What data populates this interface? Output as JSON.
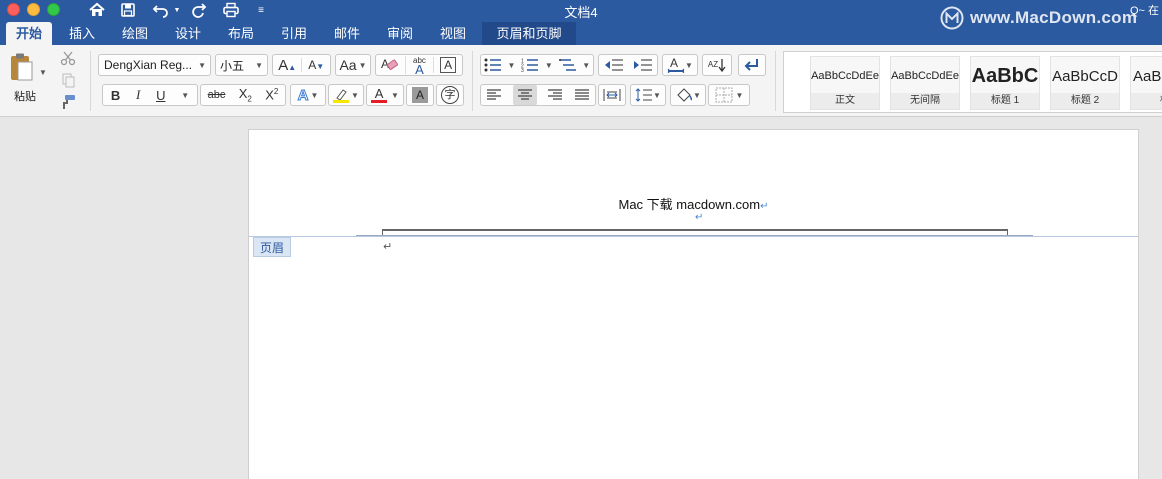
{
  "window": {
    "title": "文档4",
    "watermark": "www.MacDown.com",
    "search_hint": "Q~ 在"
  },
  "tabs": [
    {
      "label": "开始",
      "active": true
    },
    {
      "label": "插入"
    },
    {
      "label": "绘图"
    },
    {
      "label": "设计"
    },
    {
      "label": "布局"
    },
    {
      "label": "引用"
    },
    {
      "label": "邮件"
    },
    {
      "label": "审阅"
    },
    {
      "label": "视图"
    },
    {
      "label": "页眉和页脚",
      "contextual": true
    }
  ],
  "ribbon": {
    "paste_label": "粘贴",
    "font_name": "DengXian Reg...",
    "font_size": "小五",
    "grow_font": "A",
    "shrink_font": "A",
    "case": "Aa",
    "phonetic_top": "abc",
    "phonetic_bottom": "A",
    "char_border": "A",
    "bold": "B",
    "italic": "I",
    "underline": "U",
    "strikethrough": "abc",
    "subscript": "X",
    "subscript_small": "2",
    "superscript": "X",
    "superscript_small": "2",
    "text_effect": "A",
    "font_color": "A",
    "char_shading": "A",
    "enclose_char": "字",
    "sort": "AZ",
    "highlight_color": "#f6e600",
    "font_color_hex": "#e51c23"
  },
  "styles": [
    {
      "sample": "AaBbCcDdEe",
      "name": "正文"
    },
    {
      "sample": "AaBbCcDdEe",
      "name": "无间隔"
    },
    {
      "sample": "AaBbC",
      "name": "标题 1"
    },
    {
      "sample": "AaBbCcD",
      "name": "标题 2"
    },
    {
      "sample": "AaBl",
      "name": "标"
    }
  ],
  "document": {
    "header_text": "Mac 下载 macdown.com",
    "para_mark": "↵",
    "header_label": "页眉"
  }
}
